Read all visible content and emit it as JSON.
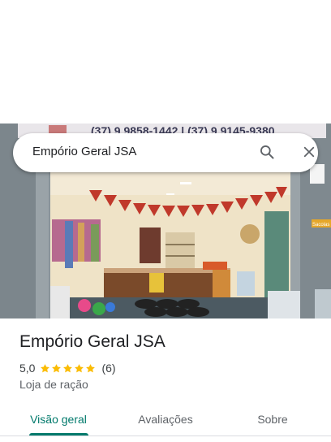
{
  "search": {
    "query": "Empório Geral JSA",
    "search_icon": "search-icon",
    "close_icon": "close-icon"
  },
  "photo": {
    "sign_text": "(37) 9 9858-1442 | (37) 9 9145-9380",
    "side_sign_text": "Sacolas"
  },
  "place": {
    "name": "Empório Geral JSA",
    "rating": "5,0",
    "stars": 5,
    "review_count": "(6)",
    "category": "Loja de ração"
  },
  "tabs": [
    {
      "label": "Visão geral",
      "active": true
    },
    {
      "label": "Avaliações",
      "active": false
    },
    {
      "label": "Sobre",
      "active": false
    }
  ],
  "colors": {
    "accent": "#00796b",
    "star": "#fbbc04",
    "bunting": "#c0392b"
  }
}
